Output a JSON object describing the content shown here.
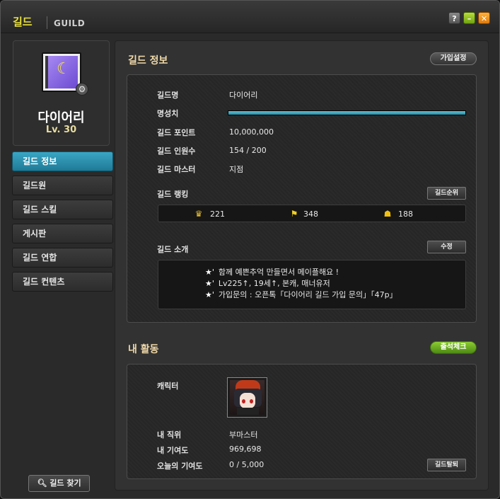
{
  "window": {
    "title_ko": "길드",
    "title_en": "GUILD",
    "help_label": "?",
    "min_label": "–",
    "close_label": "✕"
  },
  "profile": {
    "name": "다이어리",
    "level": "Lv. 30"
  },
  "menu": [
    {
      "label": "길드 정보",
      "active": true
    },
    {
      "label": "길드원"
    },
    {
      "label": "길드 스킬"
    },
    {
      "label": "게시판"
    },
    {
      "label": "길드 연합"
    },
    {
      "label": "길드 컨텐츠"
    }
  ],
  "find_button": "길드 찾기",
  "info": {
    "section_title": "길드 정보",
    "join_settings_button": "가입설정",
    "fields": {
      "name_label": "길드명",
      "name_value": "다이어리",
      "fame_label": "명성치",
      "fame_fill_fraction": 1.0,
      "points_label": "길드 포인트",
      "points_value": "10,000,000",
      "members_label": "길드 인원수",
      "members_value": "154 / 200",
      "master_label": "길드 마스터",
      "master_value": "지점"
    },
    "ranking_label": "길드 랭킹",
    "ranking_button": "길드순위",
    "ranks": [
      {
        "icon": "crown-icon",
        "value": "221"
      },
      {
        "icon": "flag-icon",
        "value": "348"
      },
      {
        "icon": "cat-icon",
        "value": "188"
      }
    ],
    "intro_label": "길드 소개",
    "intro_edit_button": "수정",
    "intro_lines": [
      "함께 예쁜추억 만들면서 메이플해요 !",
      "Lv225↑, 19세↑, 본캐, 매너유저",
      "가입문의 : 오픈톡「다이어리 길드 가입 문의」「47p」"
    ],
    "star_glyph": "★'"
  },
  "activity": {
    "section_title": "내 활동",
    "attendance_button": "출석체크",
    "character_label": "캐릭터",
    "position_label": "내 직위",
    "position_value": "부마스터",
    "contribution_label": "내 기여도",
    "contribution_value": "969,698",
    "today_label": "오늘의 기여도",
    "today_value": "0 / 5,000",
    "leave_button": "길드탈퇴"
  },
  "colors": {
    "accent_title": "#e8e03a",
    "active_menu": "#2a90ad",
    "fame_bar": "#3fa6bf",
    "green_button": "#6aac22"
  }
}
